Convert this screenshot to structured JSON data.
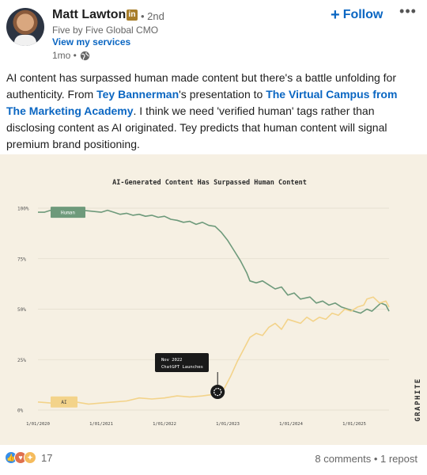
{
  "post": {
    "author": "Matt Lawton",
    "badge": "in",
    "degree": "• 2nd",
    "subtitle": "Five by Five Global CMO",
    "services_link": "View my services",
    "time": "1mo •",
    "follow_label": "Follow",
    "more_icon": "more-horizontal-icon",
    "text_1": "AI content has surpassed human made content but there's a battle unfolding for authenticity. From ",
    "mention_1": "Tey Bannerman",
    "text_2": "'s presentation to ",
    "mention_2": "The Virtual Campus from The Marketing Academy",
    "text_3": ". I think we need 'verified human' tags rather than disclosing content as AI originated. Tey predicts that human content will signal premium brand positioning."
  },
  "footer": {
    "reaction_count": "17",
    "comments": "8 comments",
    "separator": "•",
    "reposts": "1 repost"
  },
  "colors": {
    "link": "#0a66c2",
    "human_line": "#6e9a7b",
    "ai_line": "#f3d38a",
    "chart_bg": "#f6f0e3"
  },
  "chart_data": {
    "type": "line",
    "title": "AI-Generated Content Has Surpassed Human Content",
    "brand": "GRAPHITE",
    "x_ticks": [
      "1/01/2020",
      "1/01/2021",
      "1/01/2022",
      "1/01/2023",
      "1/01/2024",
      "1/01/2025"
    ],
    "y_ticks": [
      "0%",
      "25%",
      "50%",
      "75%",
      "100%"
    ],
    "ylim": [
      0,
      100
    ],
    "xlim": [
      2020.0,
      2025.55
    ],
    "grid": true,
    "annotation": {
      "line1": "Nov 2022",
      "line2": "ChatGPT Launches",
      "x": 2022.84,
      "y": 9
    },
    "series": [
      {
        "name": "Human",
        "values": [
          [
            2020.0,
            98
          ],
          [
            2020.1,
            98
          ],
          [
            2020.2,
            99
          ],
          [
            2020.35,
            98
          ],
          [
            2020.5,
            99
          ],
          [
            2020.6,
            98.5
          ],
          [
            2020.7,
            99
          ],
          [
            2020.85,
            98.5
          ],
          [
            2021.0,
            98
          ],
          [
            2021.1,
            99
          ],
          [
            2021.2,
            98
          ],
          [
            2021.3,
            97
          ],
          [
            2021.4,
            97.5
          ],
          [
            2021.5,
            96.5
          ],
          [
            2021.6,
            97
          ],
          [
            2021.7,
            96
          ],
          [
            2021.8,
            96.5
          ],
          [
            2021.9,
            95.5
          ],
          [
            2022.0,
            96
          ],
          [
            2022.1,
            94.5
          ],
          [
            2022.2,
            94
          ],
          [
            2022.3,
            93
          ],
          [
            2022.4,
            93.5
          ],
          [
            2022.5,
            92
          ],
          [
            2022.6,
            93
          ],
          [
            2022.7,
            91.5
          ],
          [
            2022.8,
            91
          ],
          [
            2022.9,
            88
          ],
          [
            2023.0,
            84
          ],
          [
            2023.1,
            79
          ],
          [
            2023.2,
            74
          ],
          [
            2023.3,
            68
          ],
          [
            2023.35,
            64
          ],
          [
            2023.45,
            63
          ],
          [
            2023.55,
            64
          ],
          [
            2023.65,
            62
          ],
          [
            2023.75,
            60
          ],
          [
            2023.85,
            61
          ],
          [
            2023.95,
            57
          ],
          [
            2024.05,
            58
          ],
          [
            2024.15,
            55
          ],
          [
            2024.3,
            56
          ],
          [
            2024.4,
            53
          ],
          [
            2024.5,
            54
          ],
          [
            2024.6,
            52
          ],
          [
            2024.7,
            53
          ],
          [
            2024.8,
            51
          ],
          [
            2024.9,
            50
          ],
          [
            2025.0,
            49
          ],
          [
            2025.1,
            48
          ],
          [
            2025.2,
            50
          ],
          [
            2025.28,
            49
          ],
          [
            2025.35,
            51
          ],
          [
            2025.42,
            53
          ],
          [
            2025.5,
            52
          ],
          [
            2025.55,
            49
          ]
        ]
      },
      {
        "name": "AI",
        "values": [
          [
            2020.0,
            4
          ],
          [
            2020.2,
            3.5
          ],
          [
            2020.4,
            4
          ],
          [
            2020.6,
            4
          ],
          [
            2020.8,
            3
          ],
          [
            2021.0,
            3.5
          ],
          [
            2021.2,
            4
          ],
          [
            2021.4,
            4.5
          ],
          [
            2021.6,
            6
          ],
          [
            2021.8,
            5.5
          ],
          [
            2022.0,
            6
          ],
          [
            2022.2,
            7
          ],
          [
            2022.4,
            6.5
          ],
          [
            2022.6,
            7
          ],
          [
            2022.84,
            8
          ],
          [
            2022.95,
            11
          ],
          [
            2023.05,
            17
          ],
          [
            2023.15,
            24
          ],
          [
            2023.25,
            30
          ],
          [
            2023.35,
            36
          ],
          [
            2023.45,
            38
          ],
          [
            2023.55,
            37
          ],
          [
            2023.65,
            41
          ],
          [
            2023.75,
            43
          ],
          [
            2023.85,
            40
          ],
          [
            2023.95,
            45
          ],
          [
            2024.05,
            44
          ],
          [
            2024.15,
            43
          ],
          [
            2024.25,
            46
          ],
          [
            2024.35,
            44
          ],
          [
            2024.45,
            46
          ],
          [
            2024.55,
            45
          ],
          [
            2024.65,
            48
          ],
          [
            2024.75,
            47
          ],
          [
            2024.85,
            50
          ],
          [
            2024.95,
            49
          ],
          [
            2025.05,
            51
          ],
          [
            2025.15,
            52
          ],
          [
            2025.2,
            55
          ],
          [
            2025.3,
            56
          ],
          [
            2025.4,
            53
          ],
          [
            2025.5,
            54
          ],
          [
            2025.55,
            51
          ]
        ]
      }
    ]
  }
}
